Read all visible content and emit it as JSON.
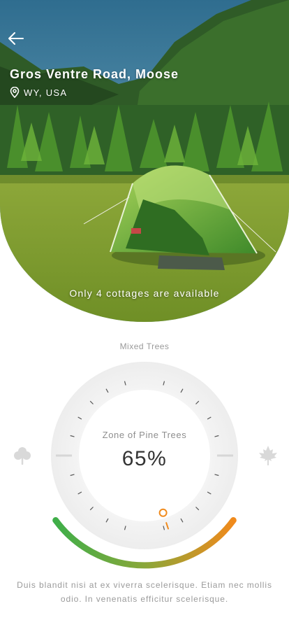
{
  "hero": {
    "title": "Gros Ventre Road, Moose",
    "location": "WY, USA",
    "availability": "Only 4 cottages are available"
  },
  "icons": {
    "back": "arrow-left-icon",
    "location": "location-pin-icon",
    "left_leaf": "clover-icon",
    "right_leaf": "maple-leaf-icon"
  },
  "dial": {
    "top_label": "Mixed Trees",
    "center_label": "Zone of Pine Trees",
    "value_text": "65%",
    "value": 0.65
  },
  "colors": {
    "gauge_start": "#3fae49",
    "gauge_end": "#f08a1c",
    "indicator": "#f08a1c"
  },
  "footer": {
    "text": "Duis blandit nisi at ex viverra scelerisque. Etiam nec mollis odio. In venenatis efficitur scelerisque."
  }
}
